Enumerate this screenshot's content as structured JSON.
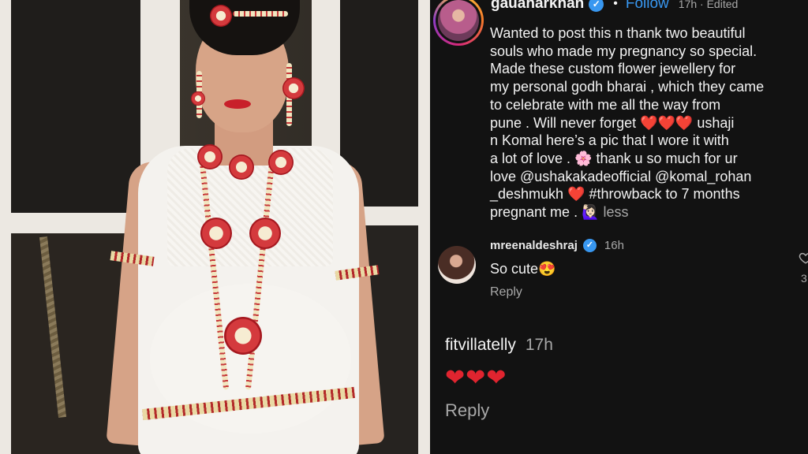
{
  "post": {
    "username": "gauaharkhan",
    "verified_mark": "✓",
    "separator": "•",
    "follow_label": "Follow",
    "meta": "17h · Edited",
    "caption_lines": [
      "Wanted to post this n thank two beautiful",
      "souls who made my pregnancy so special.",
      "Made these custom flower jewellery for",
      "my personal godh bharai , which they came",
      "to celebrate with me all the way from",
      "pune . Will never forget ❤️❤️❤️ ushaji",
      "n Komal here’s a pic that I wore it with",
      "a lot of love . 🌸 thank u so much for ur",
      "love @ushakakadeofficial @komal_rohan",
      "_deshmukh ❤️ #throwback to 7 months",
      "pregnant me . 🙋🏻‍♀️ "
    ],
    "less_label": "less"
  },
  "comments": [
    {
      "username": "mreenaldeshraj",
      "verified_mark": "✓",
      "time": "16h",
      "text": "So cute😍",
      "reply_label": "Reply",
      "like_count": "3"
    },
    {
      "username": "fitvillatelly",
      "time": "17h",
      "text": "❤❤❤",
      "reply_label": "Reply"
    }
  ],
  "colors": {
    "background": "#121212",
    "link_blue": "#3897f0",
    "secondary_text": "#a8a8a8",
    "heart_red": "#e0242f"
  },
  "icons": [
    "verified-badge-icon",
    "heart-outline-icon"
  ]
}
